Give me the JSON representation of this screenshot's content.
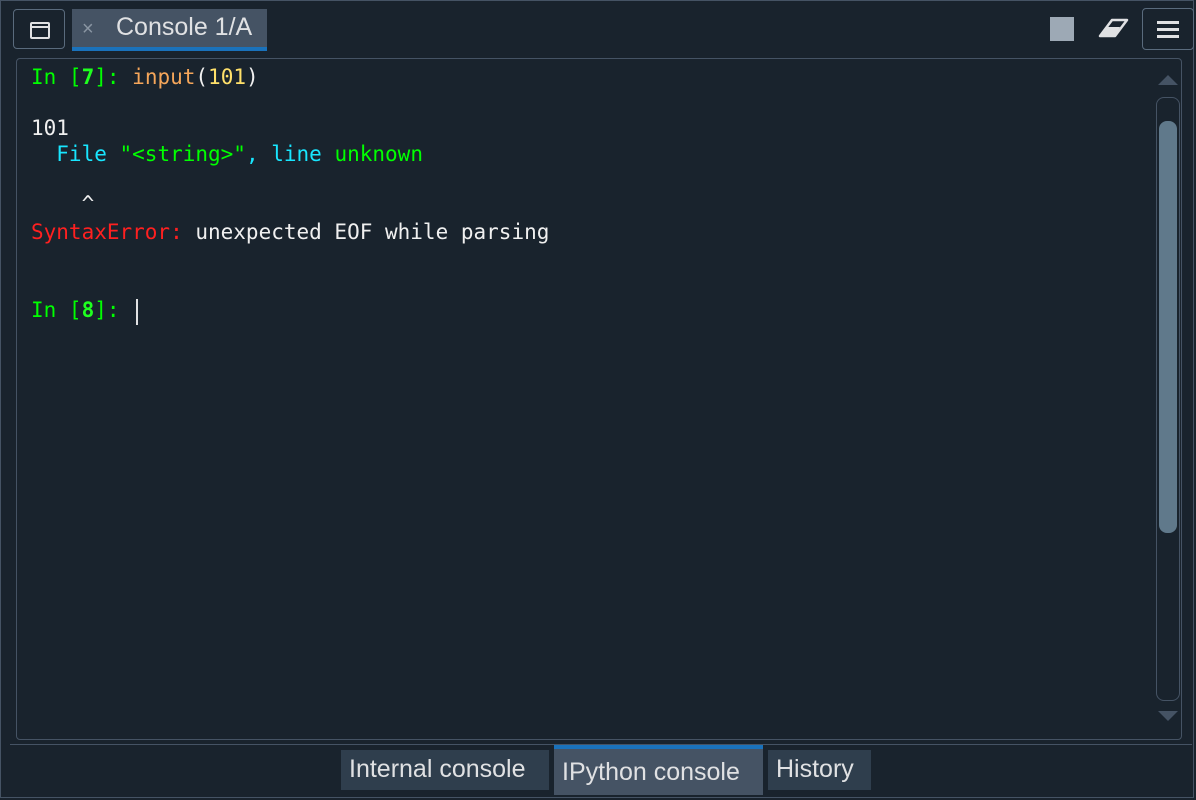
{
  "window": {
    "tab_label": "Console 1/A",
    "tab_close": "×"
  },
  "toolbar": {
    "icons": [
      "new-window-icon",
      "stop-icon",
      "eraser-icon",
      "hamburger-menu-icon"
    ]
  },
  "console": {
    "lines": {
      "prompt7": "In [",
      "prompt7_num": "7",
      "prompt7_end": "]: ",
      "input_fn": "input",
      "input_open": "(",
      "input_arg": "101",
      "input_close": ")",
      "output_value": "101",
      "file_prefix": "  File ",
      "file_name": "\"<string>\"",
      "file_sep": ", ",
      "file_line": "line",
      "file_unknown": " unknown",
      "caret_marker": "    ^",
      "error_type": "SyntaxError:",
      "error_msg": " unexpected EOF while parsing",
      "prompt8": "In [",
      "prompt8_num": "8",
      "prompt8_end": "]: "
    }
  },
  "bottom_tabs": [
    {
      "label": "Internal console",
      "active": false
    },
    {
      "label": "IPython console",
      "active": true
    },
    {
      "label": "History",
      "active": false
    }
  ],
  "colors": {
    "background": "#19232d",
    "prompt": "#00ff00",
    "error": "#ff2020",
    "accent": "#1a72bb"
  }
}
